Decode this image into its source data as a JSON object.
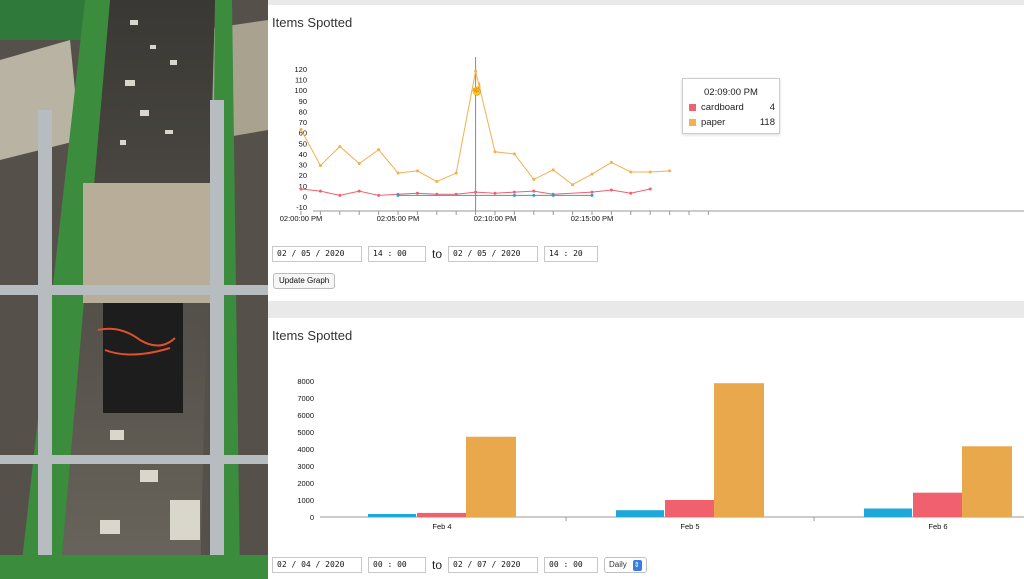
{
  "panel1": {
    "title": "Items Spotted",
    "tooltip": {
      "time": "02:09:00 PM",
      "rows": [
        {
          "label": "cardboard",
          "value": "4",
          "color": "#f0606d"
        },
        {
          "label": "paper",
          "value": "118",
          "color": "#f2b04f"
        }
      ]
    },
    "controls": {
      "from_date": "02 / 05 / 2020",
      "from_time": "14 : 00",
      "to_label": "to",
      "to_date": "02 / 05 / 2020",
      "to_time": "14 : 20",
      "update_button": "Update Graph"
    }
  },
  "panel2": {
    "title": "Items Spotted",
    "controls": {
      "from_date": "02 / 04 / 2020",
      "from_time": "00 : 00",
      "to_label": "to",
      "to_date": "02 / 07 / 2020",
      "to_time": "00 : 00",
      "interval": "Daily"
    }
  },
  "chart_data": [
    {
      "type": "line",
      "ylim": [
        -10,
        120
      ],
      "y_ticks": [
        "120",
        "110",
        "100",
        "90",
        "80",
        "70",
        "60",
        "50",
        "40",
        "30",
        "20",
        "10",
        "0",
        "-10"
      ],
      "x_ticks": [
        "02:00:00 PM",
        "02:05:00 PM",
        "02:10:00 PM",
        "02:15:00 PM"
      ],
      "hover_x": "02:09:00 PM",
      "grid": false,
      "series": [
        {
          "name": "paper",
          "color": "#f2b04f",
          "x_min": [
            0,
            1,
            2,
            3,
            4,
            5,
            6,
            7,
            8,
            9,
            10,
            11,
            12,
            13,
            14,
            15,
            16,
            17,
            18,
            19
          ],
          "values": [
            63,
            29,
            47,
            31,
            44,
            22,
            24,
            14,
            22,
            118,
            42,
            40,
            16,
            25,
            11,
            21,
            32,
            23,
            23,
            24
          ]
        },
        {
          "name": "cardboard",
          "color": "#f0606d",
          "x_min": [
            0,
            1,
            2,
            3,
            4,
            5,
            6,
            7,
            8,
            9,
            10,
            11,
            12,
            13,
            15,
            16,
            17,
            18
          ],
          "values": [
            7,
            5,
            1,
            5,
            1,
            2,
            3,
            2,
            2,
            4,
            3,
            4,
            5,
            2,
            4,
            6,
            3,
            7
          ]
        },
        {
          "name": "",
          "color": "#2a9fd6",
          "x_min": [
            5,
            11,
            12,
            13,
            15
          ],
          "values": [
            1,
            1,
            1,
            1,
            1
          ]
        }
      ]
    },
    {
      "type": "bar",
      "categories": [
        "Feb 4",
        "Feb 5",
        "Feb 6"
      ],
      "ylim": [
        0,
        8000
      ],
      "y_ticks": [
        "8000",
        "7000",
        "6000",
        "5000",
        "4000",
        "3000",
        "2000",
        "1000",
        "0"
      ],
      "series": [
        {
          "name": "",
          "color": "#1ea8d9",
          "values": [
            180,
            400,
            500
          ]
        },
        {
          "name": "cardboard",
          "color": "#f0606d",
          "values": [
            240,
            1000,
            1430
          ]
        },
        {
          "name": "paper",
          "color": "#eaa84c",
          "values": [
            4720,
            7870,
            4160
          ]
        }
      ]
    }
  ]
}
